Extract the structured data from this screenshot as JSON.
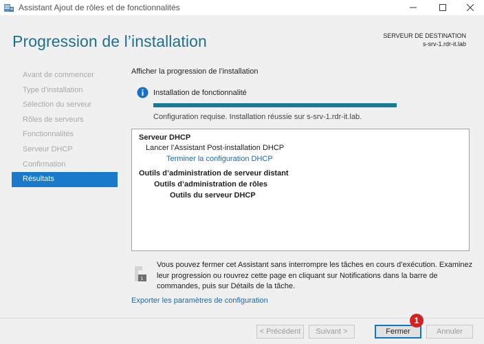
{
  "window": {
    "title": "Assistant Ajout de rôles et de fonctionnalités",
    "icon": "server-manager-icon"
  },
  "header": {
    "page_title": "Progression de l’installation",
    "destination_label": "SERVEUR DE DESTINATION",
    "destination_server": "s-srv-1.rdr-it.lab"
  },
  "steps": [
    {
      "label": "Avant de commencer",
      "active": false
    },
    {
      "label": "Type d’installation",
      "active": false
    },
    {
      "label": "Sélection du serveur",
      "active": false
    },
    {
      "label": "Rôles de serveurs",
      "active": false
    },
    {
      "label": "Fonctionnalités",
      "active": false
    },
    {
      "label": "Serveur DHCP",
      "active": false
    },
    {
      "label": "Confirmation",
      "active": false
    },
    {
      "label": "Résultats",
      "active": true
    }
  ],
  "main": {
    "section_label": "Afficher la progression de l’installation",
    "status_title": "Installation de fonctionnalité",
    "progress_fraction": 1.0,
    "status_text": "Configuration requise. Installation réussie sur s-srv-1.rdr-it.lab.",
    "results": {
      "dhcp_title": "Serveur DHCP",
      "dhcp_launch": "Lancer l’Assistant Post-installation DHCP",
      "dhcp_link": "Terminer la configuration DHCP",
      "rsat_title": "Outils d’administration de serveur distant",
      "role_tools": "Outils d’administration de rôles",
      "dhcp_tools": "Outils du serveur DHCP"
    },
    "notice": "Vous pouvez fermer cet Assistant sans interrompre les tâches en cours d’exécution. Examinez leur progression ou rouvrez cette page en cliquant sur Notifications dans la barre de commandes, puis sur Détails de la tâche.",
    "export_link": "Exporter les paramètres de configuration"
  },
  "footer": {
    "previous": "< Précédent",
    "next": "Suivant >",
    "close": "Fermer",
    "cancel": "Annuler",
    "callout_number": "1"
  },
  "colors": {
    "title_accent": "#1f6f8f",
    "active_step": "#1979ca",
    "progress": "#167a99",
    "link": "#2068a7",
    "callout": "#d32222"
  }
}
